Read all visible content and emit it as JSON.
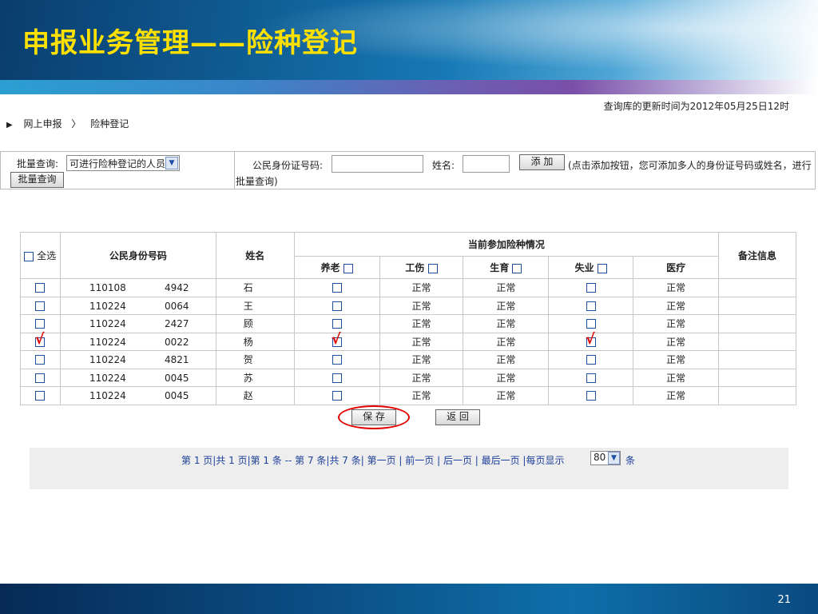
{
  "slide": {
    "title": "申报业务管理——险种登记",
    "page_number": "21"
  },
  "update_time": "查询库的更新时间为2012年05月25日12时",
  "breadcrumb": {
    "item1": "网上申报",
    "sep": "〉",
    "item2": "险种登记"
  },
  "batch": {
    "label": "批量查询:",
    "select_value": "可进行险种登记的人员",
    "batch_button": "批量查询",
    "id_label": "公民身份证号码:",
    "name_label": "姓名:",
    "add_button": "添 加",
    "hint": "(点击添加按钮，您可添加多人的身份证号码或姓名，进行批量查询)"
  },
  "table": {
    "select_all": "全选",
    "col_id": "公民身份号码",
    "col_name": "姓名",
    "col_group": "当前参加险种情况",
    "col_remark": "备注信息",
    "ins_cols": [
      "养老",
      "工伤",
      "生育",
      "失业",
      "医疗"
    ],
    "rows": [
      {
        "id1": "110108",
        "id2": "4942",
        "name": "石",
        "injury": "正常",
        "birth": "正常",
        "medical": "正常"
      },
      {
        "id1": "110224",
        "id2": "0064",
        "name": "王",
        "injury": "正常",
        "birth": "正常",
        "medical": "正常"
      },
      {
        "id1": "110224",
        "id2": "2427",
        "name": "顾",
        "injury": "正常",
        "birth": "正常",
        "medical": "正常"
      },
      {
        "id1": "110224",
        "id2": "0022",
        "name": "杨",
        "injury": "正常",
        "birth": "正常",
        "medical": "正常"
      },
      {
        "id1": "110224",
        "id2": "4821",
        "name": "贺",
        "injury": "正常",
        "birth": "正常",
        "medical": "正常"
      },
      {
        "id1": "110224",
        "id2": "0045",
        "name": "苏",
        "injury": "正常",
        "birth": "正常",
        "medical": "正常"
      },
      {
        "id1": "110224",
        "id2": "0045",
        "name": "赵",
        "injury": "正常",
        "birth": "正常",
        "medical": "正常"
      }
    ]
  },
  "actions": {
    "save": "保 存",
    "back": "返 回"
  },
  "pager": {
    "text": "第 1 页|共 1 页|第 1 条 -- 第 7 条|共 7 条| 第一页 | 前一页 | 后一页 | 最后一页 |每页显示",
    "per_page": "80",
    "unit": "条"
  }
}
